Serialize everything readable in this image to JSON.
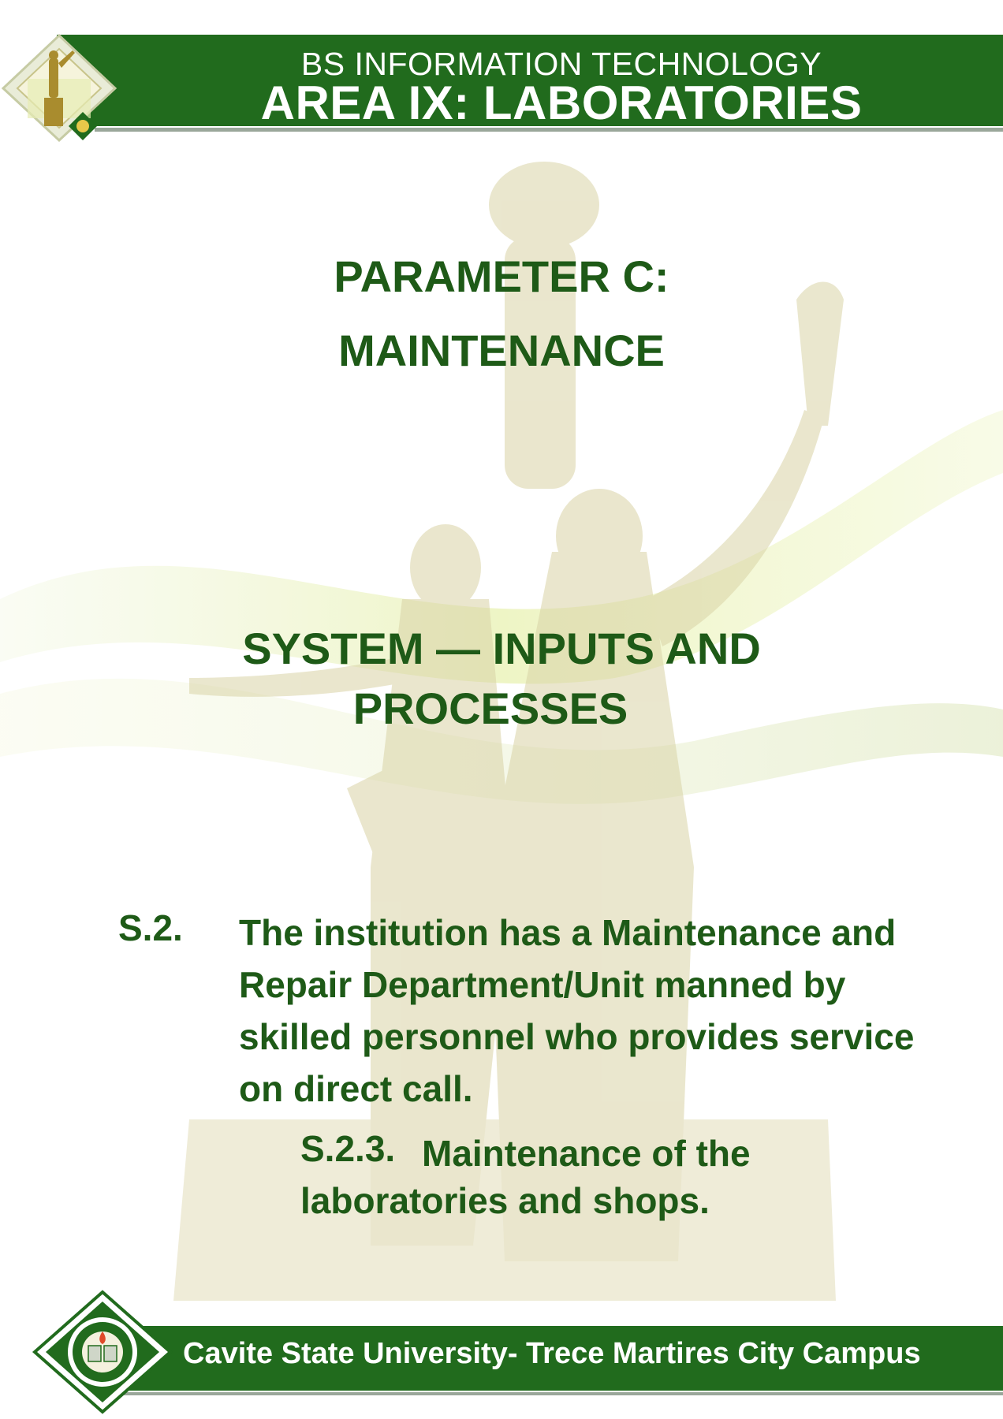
{
  "header": {
    "program": "BS INFORMATION TECHNOLOGY",
    "area": "AREA IX: LABORATORIES"
  },
  "parameter": {
    "line1": "PARAMETER C:",
    "line2": "MAINTENANCE"
  },
  "system": {
    "line1": "SYSTEM — INPUTS AND",
    "line2": "PROCESSES"
  },
  "standard": {
    "label": "S.2.",
    "text": "The institution has a Maintenance and Repair Department/Unit manned by skilled personnel who provides service on direct call."
  },
  "sub_standard": {
    "label": "S.2.3.",
    "text_line1": "Maintenance of the",
    "text_line2": "laboratories and shops."
  },
  "footer": {
    "campus": "Cavite State University- Trece Martires City Campus"
  },
  "colors": {
    "brand_green": "#216b1d",
    "text_green": "#1e5a17",
    "rule_gray": "#9aa79a"
  },
  "icons": {
    "header_logo": "statue-diamond-logo",
    "footer_seal": "university-seal"
  }
}
